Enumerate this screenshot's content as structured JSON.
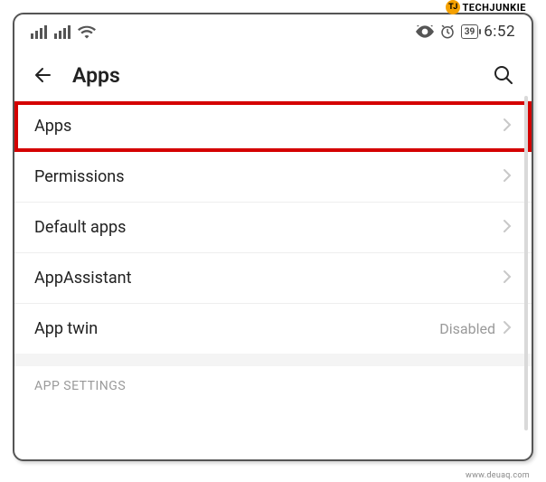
{
  "statusbar": {
    "battery_level": "39",
    "clock": "6:52"
  },
  "header": {
    "title": "Apps"
  },
  "list": {
    "items": [
      {
        "label": "Apps",
        "value": ""
      },
      {
        "label": "Permissions",
        "value": ""
      },
      {
        "label": "Default apps",
        "value": ""
      },
      {
        "label": "AppAssistant",
        "value": ""
      },
      {
        "label": "App twin",
        "value": "Disabled"
      }
    ]
  },
  "section": {
    "header": "APP SETTINGS"
  },
  "brand": {
    "name": "TECHJUNKIE",
    "mark": "TJ"
  },
  "footer": {
    "credit": "www.deuaq.com"
  }
}
